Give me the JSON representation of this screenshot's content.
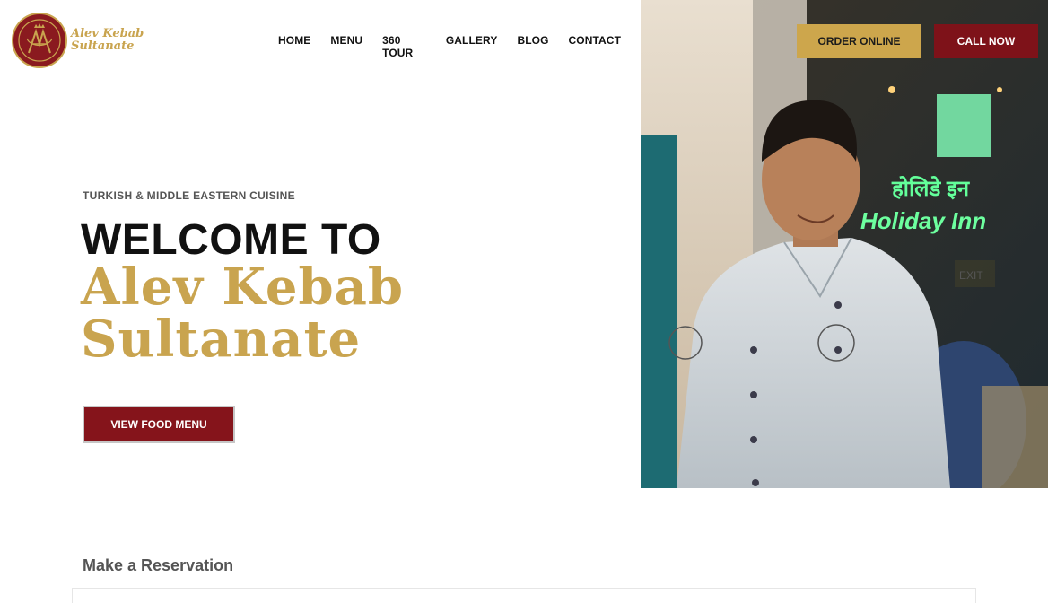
{
  "brand": {
    "name_line1": "Alev Kebab",
    "name_line2": "Sultanate",
    "logo_line1": "Alev Kebab",
    "logo_line2": "Sultanate"
  },
  "nav": {
    "items": [
      "HOME",
      "MENU",
      "360 TOUR",
      "GALLERY",
      "BLOG",
      "CONTACT"
    ]
  },
  "header_buttons": {
    "order_label": "ORDER ONLINE",
    "call_label": "CALL NOW"
  },
  "hero": {
    "eyebrow": "TURKISH & MIDDLE EASTERN CUISINE",
    "heading": "WELCOME TO",
    "cta_label": "VIEW FOOD MENU"
  },
  "reservation": {
    "title": "Make a Reservation"
  },
  "colors": {
    "gold": "#cda64c",
    "maroon": "#7e1219"
  },
  "icons": {
    "logo": "crown-monogram-icon"
  }
}
